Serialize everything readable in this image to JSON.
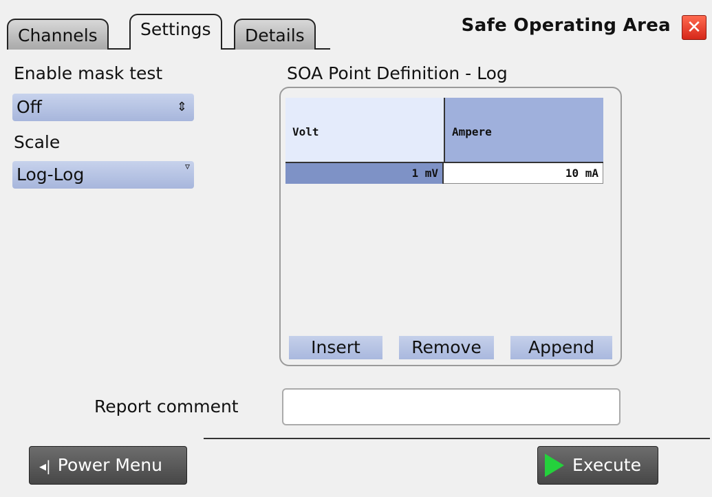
{
  "tabs": [
    {
      "label": "Channels",
      "active": false
    },
    {
      "label": "Settings",
      "active": true
    },
    {
      "label": "Details",
      "active": false
    }
  ],
  "title": "Safe Operating Area",
  "close_icon": "close-icon",
  "left": {
    "mask_label": "Enable mask test",
    "mask_value": "Off",
    "scale_label": "Scale",
    "scale_value": "Log-Log"
  },
  "soa": {
    "title": "SOA Point Definition - Log",
    "columns": [
      "Volt",
      "Ampere"
    ],
    "rows": [
      [
        "1 mV",
        "10 mA"
      ]
    ],
    "buttons": {
      "insert": "Insert",
      "remove": "Remove",
      "append": "Append"
    }
  },
  "report": {
    "label": "Report comment",
    "value": ""
  },
  "footer": {
    "power_menu": "Power Menu",
    "execute": "Execute"
  },
  "colors": {
    "accent": "#a7b6dc",
    "execute_icon": "#24d13c",
    "close": "#d6281a"
  }
}
